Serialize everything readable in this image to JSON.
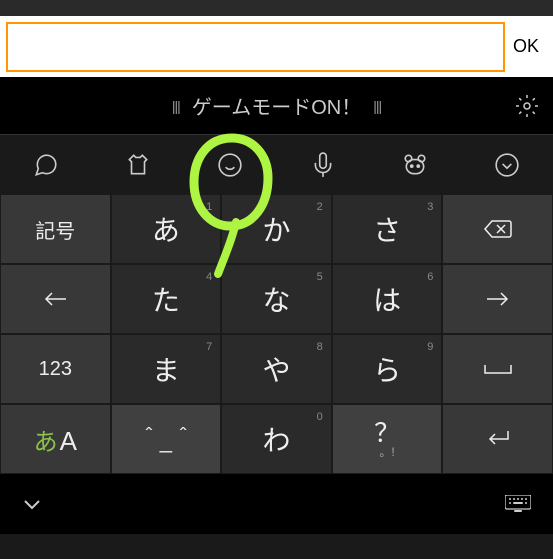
{
  "input": {
    "ok_label": "OK"
  },
  "suggestion": {
    "text": "ゲームモードON！"
  },
  "toolbar": {
    "items": [
      "chat",
      "shirt",
      "emoji",
      "mic",
      "bear",
      "chevron"
    ]
  },
  "keys": {
    "row1": {
      "func": "記号",
      "k1": "あ",
      "k2": "か",
      "k3": "さ",
      "action": "backspace"
    },
    "row2": {
      "func": "←",
      "k1": "た",
      "k2": "な",
      "k3": "は",
      "action": "→"
    },
    "row3": {
      "func": "123",
      "k1": "ま",
      "k2": "や",
      "k3": "ら",
      "action": "space"
    },
    "row4": {
      "lang_a": "あ",
      "lang_b": "A",
      "k1": "＾_＾",
      "k2": "わ",
      "k3": "？",
      "k3_sub": "。!",
      "action": "enter"
    },
    "subs": {
      "k1_r1": "1",
      "k2_r1": "2",
      "k3_r1": "3",
      "k1_r2": "4",
      "k2_r2": "5",
      "k3_r2": "6",
      "k1_r3": "7",
      "k2_r3": "8",
      "k3_r3": "9",
      "k2_r4": "0"
    }
  }
}
